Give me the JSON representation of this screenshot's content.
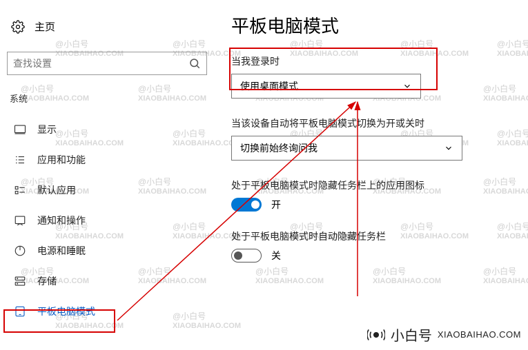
{
  "sidebar": {
    "home": "主页",
    "search_placeholder": "查找设置",
    "category": "系统",
    "items": [
      {
        "label": "显示"
      },
      {
        "label": "应用和功能"
      },
      {
        "label": "默认应用"
      },
      {
        "label": "通知和操作"
      },
      {
        "label": "电源和睡眠"
      },
      {
        "label": "存储"
      },
      {
        "label": "平板电脑模式"
      }
    ]
  },
  "main": {
    "title": "平板电脑模式",
    "login_label": "当我登录时",
    "login_value": "使用桌面模式",
    "auto_switch_label": "当该设备自动将平板电脑模式切换为开或关时",
    "auto_switch_value": "切换前始终询问我",
    "hide_icons_label": "处于平板电脑模式时隐藏任务栏上的应用图标",
    "hide_icons_state": "开",
    "hide_taskbar_label": "处于平板电脑模式时自动隐藏任务栏",
    "hide_taskbar_state": "关"
  },
  "footer": {
    "brand_cn": "小白号",
    "brand_en": "XIAOBAIHAO.COM"
  },
  "watermark": {
    "cn": "@小白号",
    "en": "XIAOBAIHAO.COM"
  }
}
